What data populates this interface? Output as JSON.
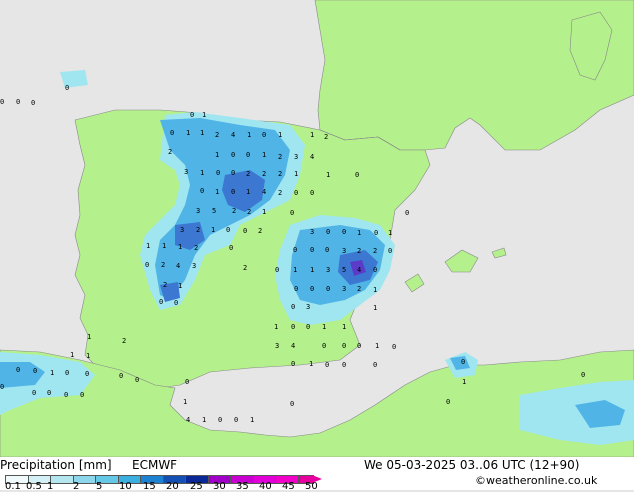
{
  "title": "Precipitation [mm]",
  "model": "ECMWF",
  "valid_time": "We 05-03-2025 03..06 UTC (12+90)",
  "credit": "©weatheronline.co.uk",
  "colors": {
    "land": "#b4f08c",
    "sea": "#e6e6e6",
    "light_rain": "#a0e6f0",
    "medium_rain": "#50b4e6",
    "heavy_rain": "#3c78d2",
    "very_heavy": "#5a3cc8"
  },
  "legend": {
    "ticks": [
      "0.1",
      "0.5",
      "1",
      "2",
      "5",
      "10",
      "15",
      "20",
      "25",
      "30",
      "35",
      "40",
      "45",
      "50"
    ],
    "colors": [
      "#f0fafa",
      "#d2f0f5",
      "#b4e6f0",
      "#8cd7eb",
      "#64c8e6",
      "#3cafe1",
      "#1e82d2",
      "#1450b4",
      "#0a2896",
      "#a000c8",
      "#c800d2",
      "#e100d7",
      "#f000c8",
      "#e600a0"
    ]
  },
  "grid_values": [
    "0",
    "0",
    "0",
    "0",
    "0",
    "1",
    "0",
    "1",
    "1",
    "2",
    "4",
    "1",
    "0",
    "1",
    "1",
    "2",
    "2",
    "1",
    "0",
    "0",
    "1",
    "2",
    "3",
    "4",
    "3",
    "1",
    "0",
    "0",
    "2",
    "2",
    "2",
    "1",
    "1",
    "0",
    "0",
    "1",
    "0",
    "1",
    "4",
    "2",
    "0",
    "0",
    "3",
    "5",
    "2",
    "2",
    "1",
    "0",
    "0",
    "3",
    "2",
    "1",
    "0",
    "0",
    "2",
    "3",
    "0",
    "0",
    "1",
    "0",
    "1",
    "1",
    "1",
    "1",
    "2",
    "0",
    "0",
    "0",
    "0",
    "3",
    "2",
    "2",
    "0",
    "0",
    "2",
    "4",
    "3",
    "2",
    "0",
    "1",
    "1",
    "3",
    "5",
    "4",
    "0",
    "2",
    "1",
    "0",
    "0",
    "0",
    "3",
    "2",
    "1",
    "0",
    "0",
    "0",
    "3",
    "1",
    "1",
    "0",
    "0",
    "1",
    "1",
    "1",
    "2",
    "3",
    "4",
    "0",
    "0",
    "0",
    "1",
    "0",
    "1",
    "1",
    "0",
    "1",
    "0",
    "0",
    "0",
    "0",
    "0",
    "0",
    "1",
    "0",
    "0",
    "0",
    "0",
    "0",
    "0",
    "1",
    "0",
    "0",
    "0",
    "0",
    "0",
    "1",
    "0",
    "0",
    "4",
    "1",
    "0",
    "0",
    "1"
  ]
}
